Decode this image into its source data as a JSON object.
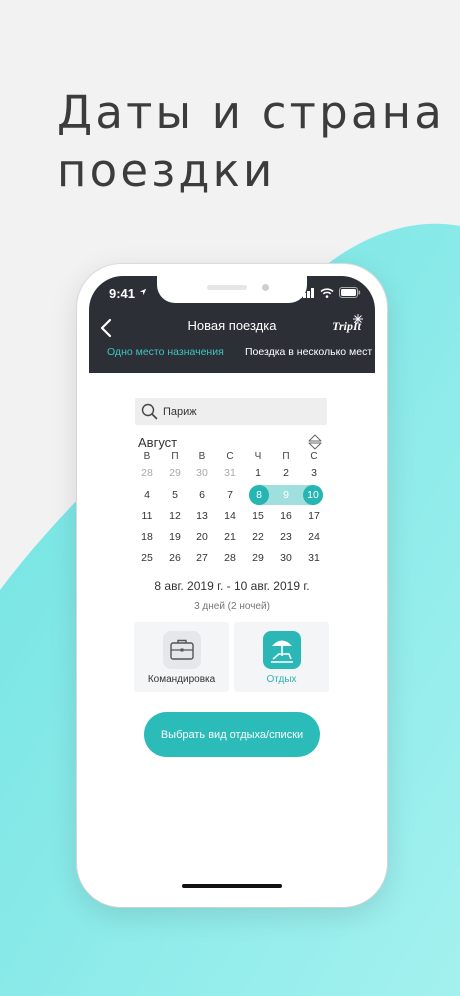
{
  "headline": {
    "line1": "Даты и страна",
    "line2": "поездки"
  },
  "colors": {
    "accent": "#2bbcb9",
    "dark_header": "#2c2f36",
    "range_light": "#9fe0de",
    "wave": "#7fe7e6"
  },
  "status_bar": {
    "time": "9:41",
    "icons": [
      "location-arrow-icon",
      "signal-icon",
      "wifi-icon",
      "battery-icon"
    ]
  },
  "nav": {
    "title": "Новая поездка",
    "logo": "TripIt",
    "back_icon": "chevron-left-icon"
  },
  "segments": {
    "one_destination": "Одно место назначения",
    "multi_destination": "Поездка в несколько мест"
  },
  "search": {
    "value": "Париж",
    "icon": "search-icon"
  },
  "calendar": {
    "month": "Август",
    "weekdays": [
      "В",
      "П",
      "В",
      "С",
      "Ч",
      "П",
      "С"
    ],
    "weeks": [
      [
        "28",
        "29",
        "30",
        "31",
        "1",
        "2",
        "3"
      ],
      [
        "4",
        "5",
        "6",
        "7",
        "8",
        "9",
        "10"
      ],
      [
        "11",
        "12",
        "13",
        "14",
        "15",
        "16",
        "17"
      ],
      [
        "18",
        "19",
        "20",
        "21",
        "22",
        "23",
        "24"
      ],
      [
        "25",
        "26",
        "27",
        "28",
        "29",
        "30",
        "31"
      ]
    ],
    "selected_range": [
      "8",
      "9",
      "10"
    ]
  },
  "trip_summary": {
    "range": "8 авг. 2019 г. - 10 авг. 2019 г.",
    "duration": "3 дней (2 ночей)"
  },
  "trip_types": {
    "business": {
      "label": "Командировка",
      "icon": "briefcase-icon"
    },
    "leisure": {
      "label": "Отдых",
      "icon": "beach-umbrella-icon",
      "selected": true
    }
  },
  "cta": {
    "label": "Выбрать вид отдыха/списки"
  }
}
